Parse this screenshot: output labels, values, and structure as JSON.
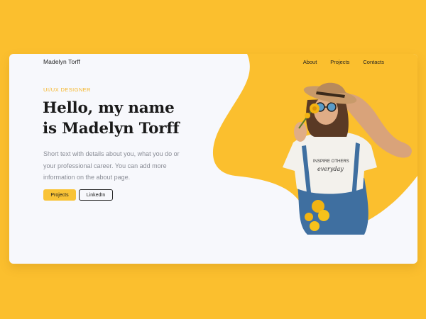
{
  "nav": {
    "brand": "Madelyn Torff",
    "links": [
      "About",
      "Projects",
      "Contacts"
    ]
  },
  "hero": {
    "eyebrow": "UI/UX DESIGNER",
    "headline_line1": "Hello,  my name",
    "headline_line2": "is Madelyn Torff",
    "description": "Short text with details about you, what you do or your professional career. You can add more information on the about page."
  },
  "buttons": {
    "primary": "Projects",
    "secondary": "LinkedIn"
  },
  "photo": {
    "tshirt_text_line1": "INSPIRE OTHERS",
    "tshirt_text_line2": "everyday"
  },
  "colors": {
    "background": "#FBBF2E",
    "card": "#F7F8FC",
    "accent": "#F5B62B",
    "button_primary": "#F9C336",
    "text_dark": "#1a1a1a",
    "text_muted": "#8a8d96"
  }
}
